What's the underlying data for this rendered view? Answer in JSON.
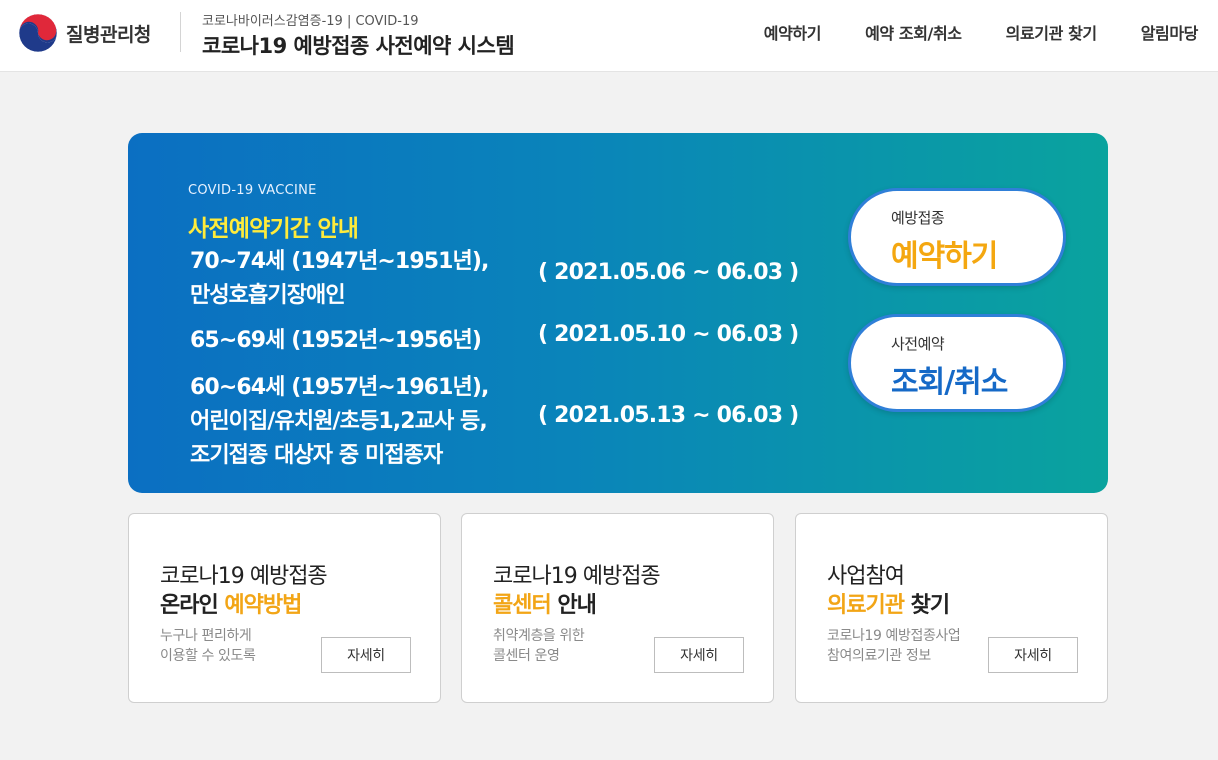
{
  "header": {
    "logo_icon": "taegeuk-emblem-icon",
    "org_name": "질병관리청",
    "site_sub": "코로나바이러스감염증-19 | COVID-19",
    "site_title": "코로나19 예방접종 사전예약 시스템",
    "nav": [
      {
        "label": "예약하기"
      },
      {
        "label": "예약 조회/취소"
      },
      {
        "label": "의료기관 찾기"
      },
      {
        "label": "알림마당"
      }
    ]
  },
  "banner": {
    "eyebrow": "COVID-19 VACCINE",
    "heading": "사전예약기간 안내",
    "groups": [
      {
        "lines": [
          "70~74세 (1947년~1951년),",
          "만성호흡기장애인"
        ],
        "period": "( 2021.05.06 ~ 06.03 )"
      },
      {
        "lines": [
          "65~69세 (1952년~1956년)"
        ],
        "period": "( 2021.05.10 ~ 06.03 )"
      },
      {
        "lines": [
          "60~64세 (1957년~1961년),",
          "어린이집/유치원/초등1,2교사 등,",
          "조기접종 대상자 중 미접종자"
        ],
        "period": "( 2021.05.13 ~ 06.03 )"
      }
    ],
    "buttons": {
      "reserve": {
        "small": "예방접종",
        "big": "예약하기"
      },
      "check": {
        "small": "사전예약",
        "big": "조회/취소"
      }
    },
    "colors": {
      "gradient_start": "#0b6fc2",
      "gradient_end": "#0aa39e",
      "heading": "#ffeb3b",
      "reserve_accent": "#f4a710",
      "check_accent": "#1569c7"
    }
  },
  "cards": [
    {
      "line1": "코로나19 예방접종",
      "line2_highlight_first": false,
      "line2_dark_a": "온라인 ",
      "line2_highlight": "예약방법",
      "line2_dark_b": "",
      "desc": [
        "누구나 편리하게",
        "이용할 수 있도록"
      ],
      "button": "자세히"
    },
    {
      "line1": "코로나19 예방접종",
      "line2_dark_a": "",
      "line2_highlight": "콜센터",
      "line2_dark_b": " 안내",
      "desc": [
        "취약계층을 위한",
        "콜센터 운영"
      ],
      "button": "자세히"
    },
    {
      "line1": "사업참여",
      "line2_dark_a": "",
      "line2_highlight": "의료기관",
      "line2_dark_b": " 찾기",
      "desc": [
        "코로나19 예방접종사업",
        "참여의료기관 정보"
      ],
      "button": "자세히"
    }
  ],
  "accent_color": "#f2a516"
}
